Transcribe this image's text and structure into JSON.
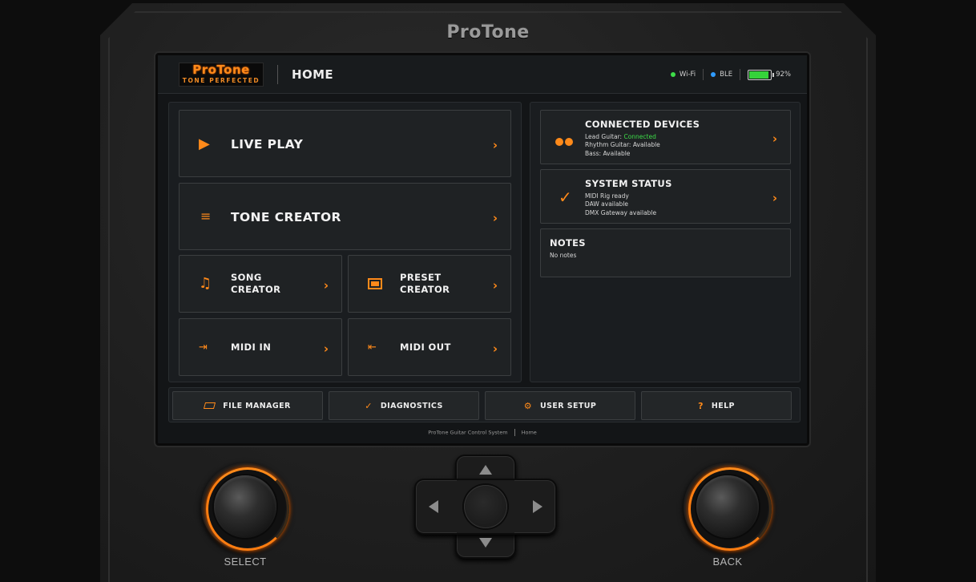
{
  "device": {
    "brand": "ProTone"
  },
  "topbar": {
    "logo_main": "ProTone",
    "logo_sub": "TONE PERFECTED",
    "page_title": "HOME",
    "wifi_label": "Wi-Fi",
    "ble_label": "BLE",
    "battery_label": "92%",
    "battery_level": 0.92,
    "wifi_color": "#3ddc48",
    "ble_color": "#2f9bff",
    "battery_color": "#35d33a"
  },
  "tiles": {
    "live_play": {
      "label": "LIVE PLAY",
      "icon": "play-icon"
    },
    "tone_creator": {
      "label": "TONE CREATOR",
      "icon": "menu-lines-icon"
    },
    "song_creator": {
      "label_line1": "SONG",
      "label_line2": "CREATOR",
      "icon": "music-note-icon"
    },
    "preset_creator": {
      "label_line1": "PRESET",
      "label_line2": "CREATOR",
      "icon": "preset-square-icon"
    },
    "midi_in": {
      "label": "MIDI IN",
      "icon": "arrow-into-bar-icon"
    },
    "midi_out": {
      "label": "MIDI OUT",
      "icon": "arrow-out-bar-icon"
    }
  },
  "cards": {
    "connected_devices": {
      "title": "CONNECTED DEVICES",
      "line1_prefix": "Lead Guitar: ",
      "line1_status": "Connected",
      "line2": "Rhythm Guitar: Available",
      "line3": "Bass: Available"
    },
    "system_status": {
      "title": "SYSTEM STATUS",
      "line1": "MIDI Rig ready",
      "line2": "DAW available",
      "line3": "DMX Gateway available"
    },
    "notes": {
      "title": "NOTES",
      "text": "No notes"
    }
  },
  "bottom_bar": {
    "file_manager": "FILE MANAGER",
    "diagnostics": "DIAGNOSTICS",
    "user_setup": "USER SETUP",
    "help": "HELP"
  },
  "footer": {
    "system_name": "ProTone Guitar Control System",
    "location": "Home"
  },
  "controls": {
    "select_label": "SELECT",
    "back_label": "BACK"
  },
  "accent_color": "#ff8a1a"
}
